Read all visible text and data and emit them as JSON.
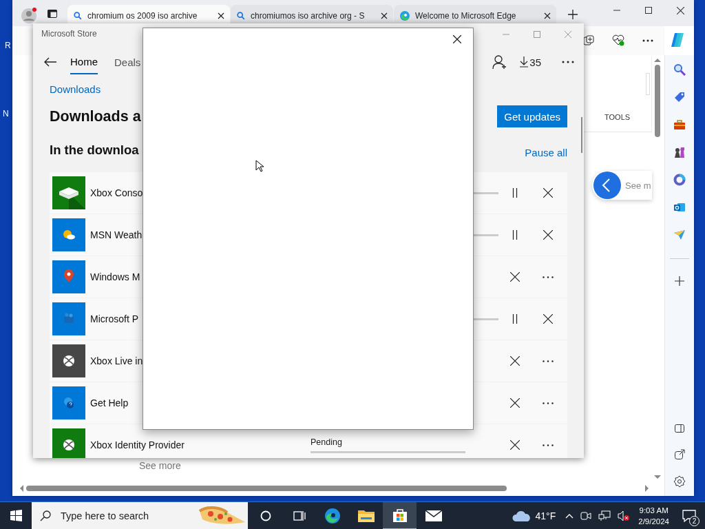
{
  "desktop": {
    "labels": [
      "R",
      "N"
    ]
  },
  "browser": {
    "tabs": [
      {
        "title": "chromium os 2009 iso archive",
        "kind": "search",
        "selected": true
      },
      {
        "title": "chromiumos iso archive org - S",
        "kind": "search",
        "selected": false
      },
      {
        "title": "Welcome to Microsoft Edge",
        "kind": "edge",
        "selected": false
      }
    ],
    "page": {
      "tools_label": "TOOLS",
      "see_more_partial": "See m",
      "see_more": "See more"
    }
  },
  "store": {
    "title": "Microsoft Store",
    "nav": [
      {
        "label": "Home",
        "selected": true
      },
      {
        "label": "Deals",
        "selected": false
      }
    ],
    "download_count": "35",
    "breadcrumb": "Downloads",
    "heading": "Downloads a",
    "section": "In the downloa",
    "get_updates": "Get updates",
    "pause_all": "Pause all",
    "rows": [
      {
        "name": "Xbox Conso",
        "kind": "console",
        "color": "#107c10",
        "downloading": true
      },
      {
        "name": "MSN Weath",
        "kind": "weather",
        "color": "#0078d7",
        "downloading": true
      },
      {
        "name": "Windows M",
        "kind": "maps",
        "color": "#0078d7",
        "downloading": false
      },
      {
        "name": "Microsoft P",
        "kind": "people",
        "color": "#0078d7",
        "downloading": true
      },
      {
        "name": "Xbox Live in",
        "kind": "xbox",
        "color": "#474747",
        "downloading": false
      },
      {
        "name": "Get Help",
        "kind": "help",
        "color": "#0078d7",
        "downloading": false
      },
      {
        "name": "Xbox Identity Provider",
        "kind": "xbox",
        "color": "#107c10",
        "downloading": false,
        "status": "Pending"
      }
    ]
  },
  "taskbar": {
    "search_placeholder": "Type here to search",
    "apps": [
      {
        "kind": "edge",
        "selected": false
      },
      {
        "kind": "folder",
        "selected": false
      },
      {
        "kind": "store",
        "selected": true
      },
      {
        "kind": "mail",
        "selected": false
      }
    ],
    "temperature": "41°F",
    "time": "9:03 AM",
    "date": "2/9/2024",
    "notifications": "2"
  }
}
